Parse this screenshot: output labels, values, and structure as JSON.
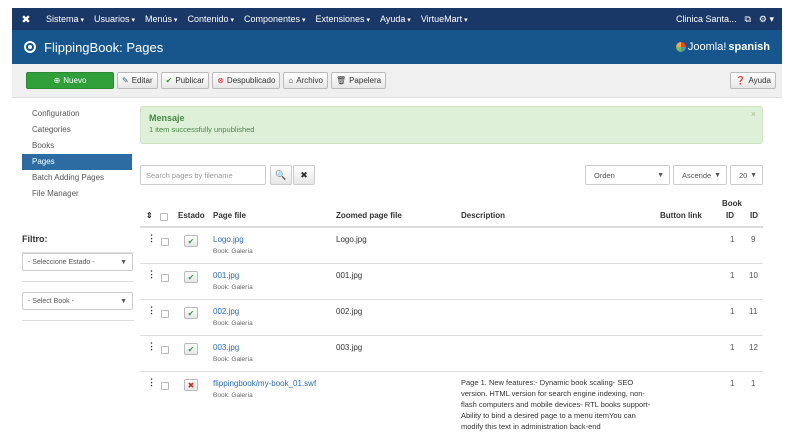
{
  "topnav": {
    "menus": [
      "Sistema",
      "Usuarios",
      "Menús",
      "Contenido",
      "Componentes",
      "Extensiones",
      "Ayuda",
      "VirtueMart"
    ],
    "site_name": "Clinica Santa..."
  },
  "header": {
    "title": "FlippingBook: Pages",
    "brand_prefix": "Joomla!",
    "brand_suffix": "spanish"
  },
  "toolbar": {
    "new": "Nuevo",
    "edit": "Editar",
    "publish": "Publicar",
    "unpublish": "Despublicado",
    "archive": "Archivo",
    "trash": "Papelera",
    "help": "Ayuda"
  },
  "sidebar": {
    "items": [
      "Configuration",
      "Categories",
      "Books",
      "Pages",
      "Batch Adding Pages",
      "File Manager"
    ],
    "active": 3
  },
  "filters": {
    "heading": "Filtro:",
    "state": "- Seleccione Estado -",
    "book": "- Select Book -"
  },
  "message": {
    "title": "Mensaje",
    "text": "1 item successfully unpublished"
  },
  "list": {
    "search_placeholder": "Search pages by filename",
    "order": "Orden",
    "direction": "Ascende",
    "limit": "20"
  },
  "table": {
    "headers": {
      "estado": "Estado",
      "page_file": "Page file",
      "zoomed": "Zoomed page file",
      "description": "Description",
      "button_link": "Button link",
      "book_id_1": "Book",
      "book_id_2": "ID",
      "id": "ID"
    },
    "rows": [
      {
        "page": "Logo.jpg",
        "book": "Book: Galería",
        "zoomed": "Logo.jpg",
        "description": "",
        "book_id": "1",
        "id": "9",
        "published": true
      },
      {
        "page": "001.jpg",
        "book": "Book: Galería",
        "zoomed": "001.jpg",
        "description": "",
        "book_id": "1",
        "id": "10",
        "published": true
      },
      {
        "page": "002.jpg",
        "book": "Book: Galería",
        "zoomed": "002.jpg",
        "description": "",
        "book_id": "1",
        "id": "11",
        "published": true
      },
      {
        "page": "003.jpg",
        "book": "Book: Galería",
        "zoomed": "003.jpg",
        "description": "",
        "book_id": "1",
        "id": "12",
        "published": true
      },
      {
        "page": "flippingbook/my-book_01.swf",
        "book": "Book: Galería",
        "zoomed": "",
        "description": "Page 1. New features:- Dynamic book scaling- SEO version. HTML version for search engine indexing, non-flash computers and mobile devices- RTL books support- Ability to bind a desired page to a menu itemYou can modify this text in administration back-end",
        "book_id": "1",
        "id": "1",
        "published": false
      }
    ]
  }
}
